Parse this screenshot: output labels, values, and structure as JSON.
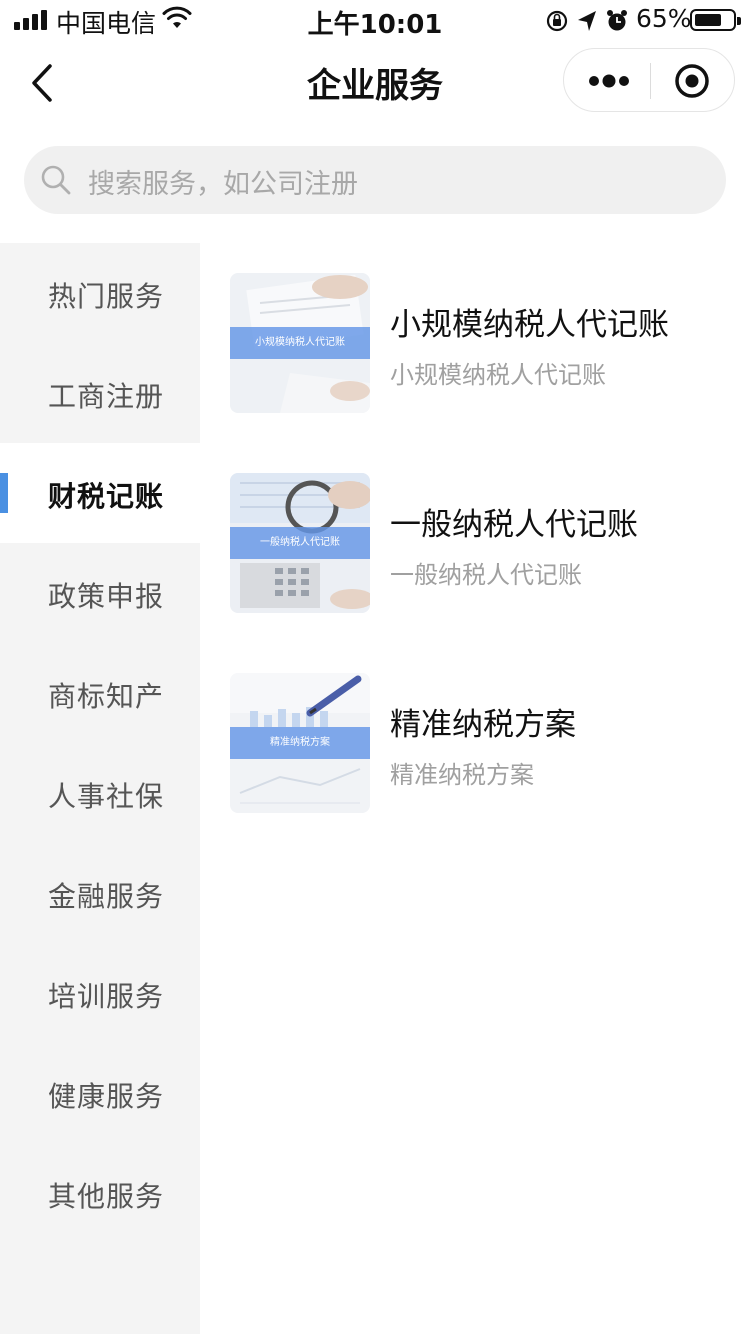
{
  "status_bar": {
    "carrier": "中国电信",
    "time": "上午10:01",
    "battery_percent": "65%",
    "icons": [
      "signal-icon",
      "wifi-icon",
      "rotation-lock-icon",
      "location-icon",
      "alarm-icon",
      "battery-icon"
    ]
  },
  "nav": {
    "title": "企业服务",
    "back_icon": "chevron-left-icon",
    "more_icon": "more-dots-icon",
    "close_icon": "target-circle-icon"
  },
  "search": {
    "placeholder": "搜索服务，如公司注册",
    "icon": "search-icon"
  },
  "sidebar": {
    "active_index": 2,
    "accent_color": "#4a90e2",
    "items": [
      {
        "label": "热门服务"
      },
      {
        "label": "工商注册"
      },
      {
        "label": "财税记账"
      },
      {
        "label": "政策申报"
      },
      {
        "label": "商标知产"
      },
      {
        "label": "人事社保"
      },
      {
        "label": "金融服务"
      },
      {
        "label": "培训服务"
      },
      {
        "label": "健康服务"
      },
      {
        "label": "其他服务"
      }
    ]
  },
  "services": [
    {
      "title": "小规模纳税人代记账",
      "subtitle": "小规模纳税人代记账",
      "thumb_caption": "小规模纳税人代记账"
    },
    {
      "title": "一般纳税人代记账",
      "subtitle": "一般纳税人代记账",
      "thumb_caption": "一般纳税人代记账"
    },
    {
      "title": "精准纳税方案",
      "subtitle": "精准纳税方案",
      "thumb_caption": "精准纳税方案"
    }
  ]
}
